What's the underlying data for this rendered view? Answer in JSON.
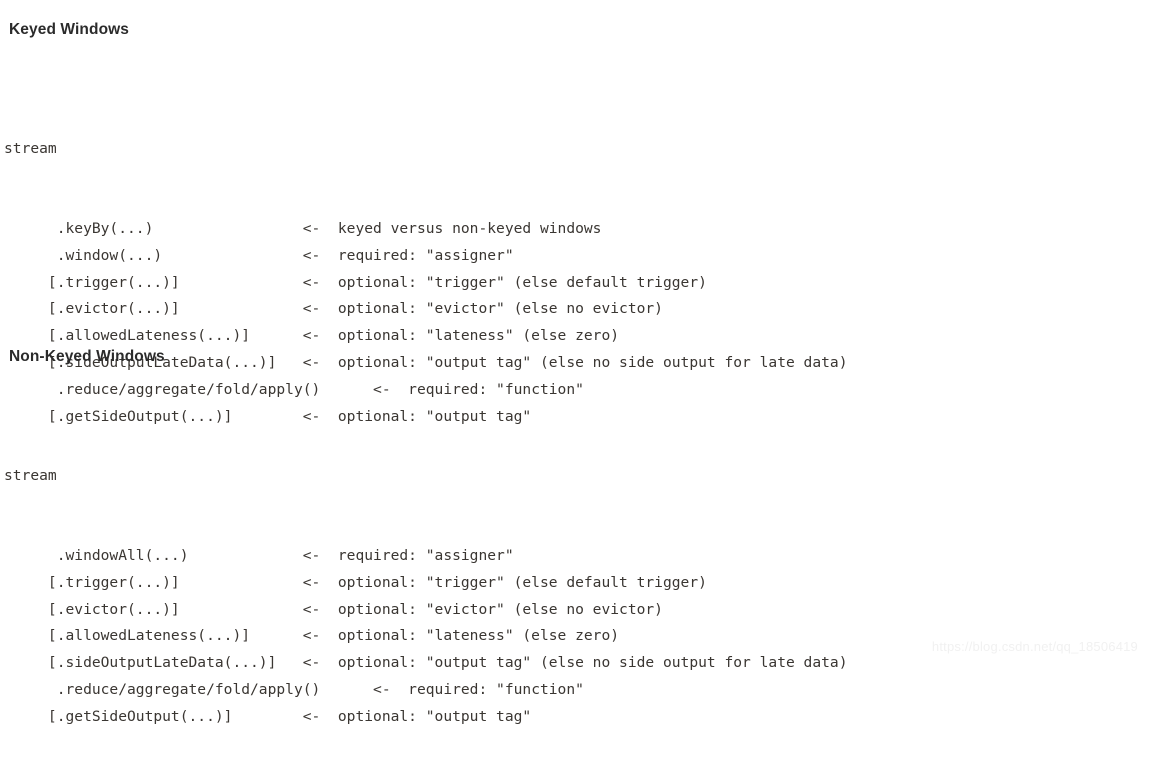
{
  "document": {
    "background_color": "#ffffff",
    "text_color": "#3a3632",
    "heading_color": "#2b2b2b",
    "watermark_color": "#f1f1f1"
  },
  "sections": [
    {
      "heading": "Keyed Windows",
      "stream_label": "stream",
      "lines": [
        {
          "call": "      .keyBy(...)                 ",
          "arrow": "<-",
          "comment": "  keyed versus non-keyed windows"
        },
        {
          "call": "      .window(...)                ",
          "arrow": "<-",
          "comment": "  required: \"assigner\""
        },
        {
          "call": "     [.trigger(...)]              ",
          "arrow": "<-",
          "comment": "  optional: \"trigger\" (else default trigger)"
        },
        {
          "call": "     [.evictor(...)]              ",
          "arrow": "<-",
          "comment": "  optional: \"evictor\" (else no evictor)"
        },
        {
          "call": "     [.allowedLateness(...)]      ",
          "arrow": "<-",
          "comment": "  optional: \"lateness\" (else zero)"
        },
        {
          "call": "     [.sideOutputLateData(...)]   ",
          "arrow": "<-",
          "comment": "  optional: \"output tag\" (else no side output for late data)"
        },
        {
          "call": "      .reduce/aggregate/fold/apply()      ",
          "arrow": "<-",
          "comment": "  required: \"function\""
        },
        {
          "call": "     [.getSideOutput(...)]        ",
          "arrow": "<-",
          "comment": "  optional: \"output tag\""
        }
      ]
    },
    {
      "heading": "Non-Keyed Windows",
      "stream_label": "stream",
      "lines": [
        {
          "call": "      .windowAll(...)             ",
          "arrow": "<-",
          "comment": "  required: \"assigner\""
        },
        {
          "call": "     [.trigger(...)]              ",
          "arrow": "<-",
          "comment": "  optional: \"trigger\" (else default trigger)"
        },
        {
          "call": "     [.evictor(...)]              ",
          "arrow": "<-",
          "comment": "  optional: \"evictor\" (else no evictor)"
        },
        {
          "call": "     [.allowedLateness(...)]      ",
          "arrow": "<-",
          "comment": "  optional: \"lateness\" (else zero)"
        },
        {
          "call": "     [.sideOutputLateData(...)]   ",
          "arrow": "<-",
          "comment": "  optional: \"output tag\" (else no side output for late data)"
        },
        {
          "call": "      .reduce/aggregate/fold/apply()      ",
          "arrow": "<-",
          "comment": "  required: \"function\""
        },
        {
          "call": "     [.getSideOutput(...)]        ",
          "arrow": "<-",
          "comment": "  optional: \"output tag\""
        }
      ]
    }
  ],
  "watermark": {
    "text": "https://blog.csdn.net/qq_18506419"
  }
}
